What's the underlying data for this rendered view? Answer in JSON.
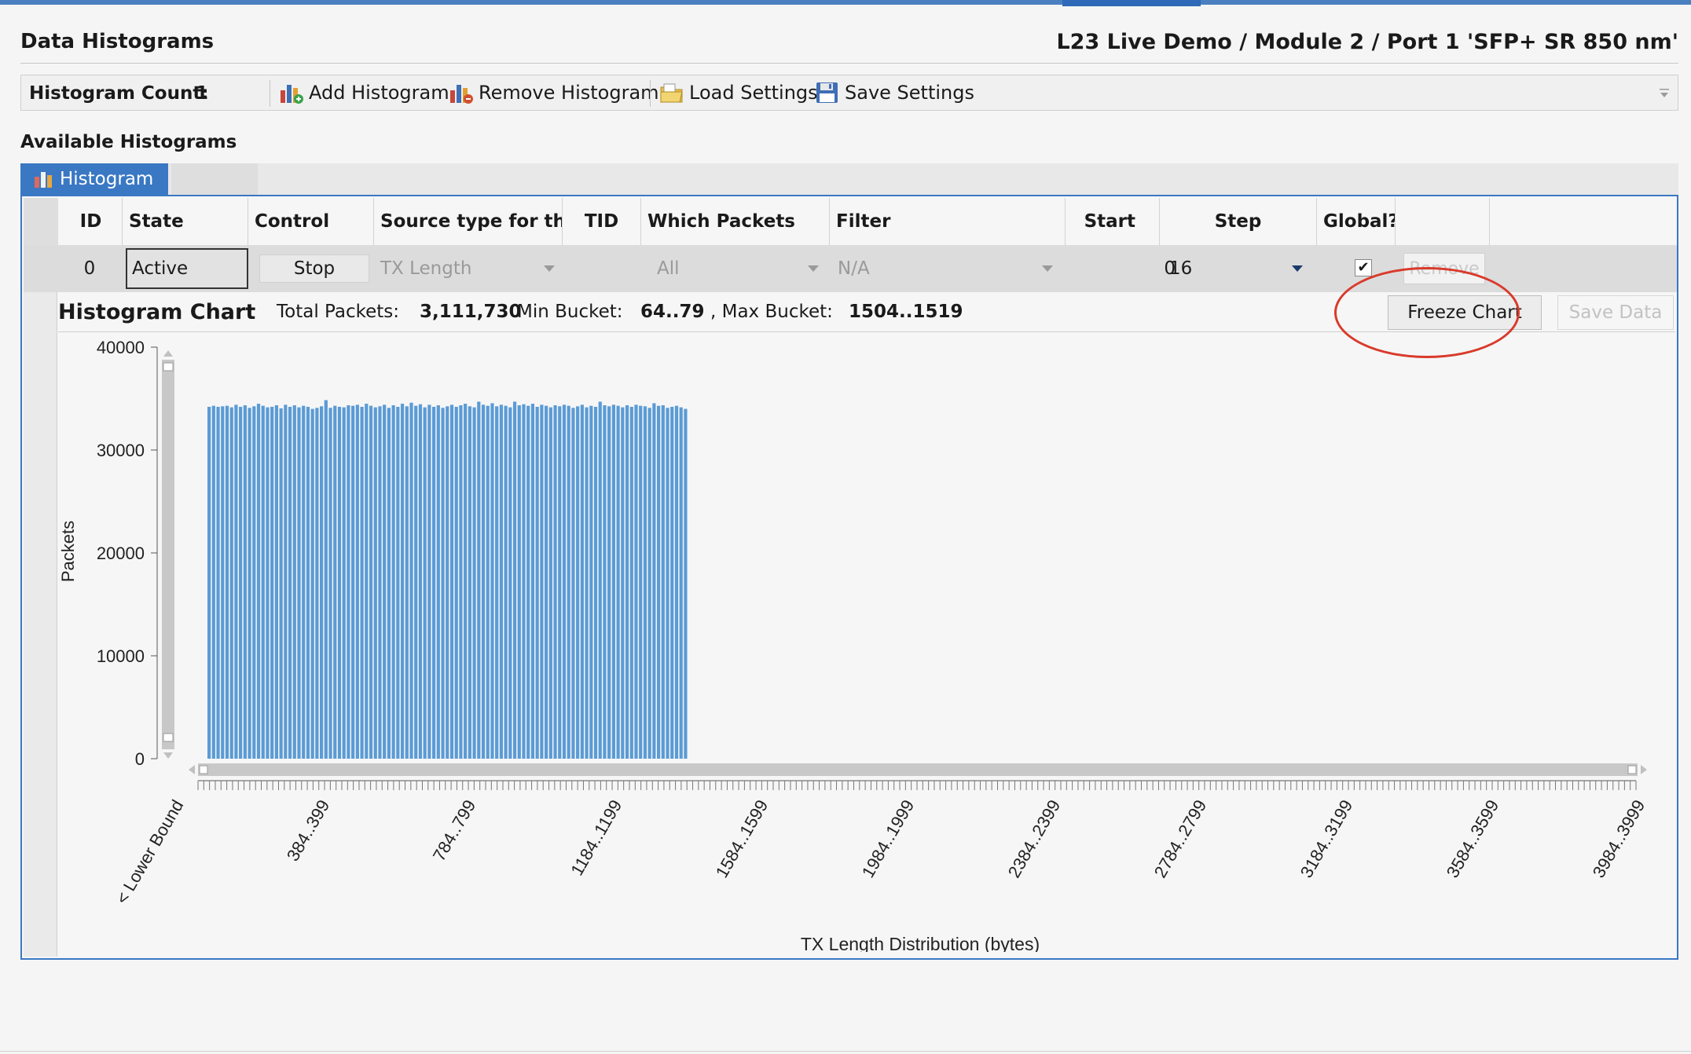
{
  "header": {
    "title": "Data Histograms",
    "context": "L23 Live Demo / Module 2 / Port 1 'SFP+ SR 850 nm'"
  },
  "toolbar": {
    "count_label": "Histogram Count:",
    "count_value": "1",
    "add_label": "Add Histogram",
    "remove_label": "Remove Histogram",
    "load_label": "Load Settings",
    "save_label": "Save Settings"
  },
  "available_label": "Available Histograms",
  "tab": {
    "label": "Histogram"
  },
  "grid": {
    "columns": [
      "ID",
      "State",
      "Control",
      "Source type for the",
      "TID",
      "Which Packets",
      "Filter",
      "Start",
      "Step",
      "Global?"
    ],
    "row": {
      "id": "0",
      "state": "Active",
      "control": "Stop",
      "source_type": "TX Length",
      "tid": "",
      "which_packets": "All",
      "filter": "N/A",
      "start": "0",
      "step": "16",
      "global_checked": true,
      "remove_label": "Remove"
    }
  },
  "chart_header": {
    "title": "Histogram Chart",
    "total_label": "Total Packets:",
    "total_value": "3,111,730",
    "min_label": "Min Bucket:",
    "min_value": "64..79",
    "max_sep": ", Max Bucket:",
    "max_value": "1504..1519",
    "freeze_label": "Freeze Chart",
    "savedata_label": "Save Data"
  },
  "colors": {
    "bar": "#5b9bd5",
    "accent": "#3a78c4",
    "highlight": "#d93a2b"
  },
  "chart_data": {
    "type": "bar",
    "ylabel": "Packets",
    "xlabel": "TX Length Distribution (bytes)",
    "ylim": [
      0,
      40000
    ],
    "yticks": [
      0,
      10000,
      20000,
      30000,
      40000
    ],
    "xtick_labels": [
      "< Lower Bound",
      "384..399",
      "784..799",
      "1184..1199",
      "1584..1599",
      "1984..1999",
      "2384..2399",
      "2784..2799",
      "3184..3199",
      "3584..3599",
      "3984..3999"
    ],
    "bucket_step": 16,
    "first_bucket_start": 64,
    "last_bucket_start": 1504,
    "values": [
      34200,
      34300,
      34200,
      34250,
      34300,
      34150,
      34400,
      34200,
      34350,
      34100,
      34250,
      34500,
      34300,
      34150,
      34200,
      34350,
      34050,
      34400,
      34200,
      34350,
      34150,
      34300,
      34200,
      34000,
      34100,
      34250,
      34850,
      34100,
      34300,
      34200,
      34150,
      34350,
      34300,
      34400,
      34200,
      34500,
      34300,
      34150,
      34250,
      34400,
      34100,
      34350,
      34200,
      34500,
      34250,
      34600,
      34300,
      34450,
      34150,
      34400,
      34200,
      34350,
      34100,
      34250,
      34400,
      34200,
      34350,
      34500,
      34250,
      34150,
      34700,
      34400,
      34300,
      34550,
      34250,
      34400,
      34300,
      34150,
      34700,
      34350,
      34450,
      34300,
      34500,
      34200,
      34400,
      34300,
      34150,
      34350,
      34250,
      34400,
      34300,
      34100,
      34250,
      34400,
      34150,
      34300,
      34200,
      34700,
      34350,
      34250,
      34400,
      34300,
      34150,
      34350,
      34200,
      34400,
      34300,
      34250,
      34100,
      34550,
      34300,
      34350,
      34100,
      34200,
      34300,
      34150,
      34000
    ]
  }
}
